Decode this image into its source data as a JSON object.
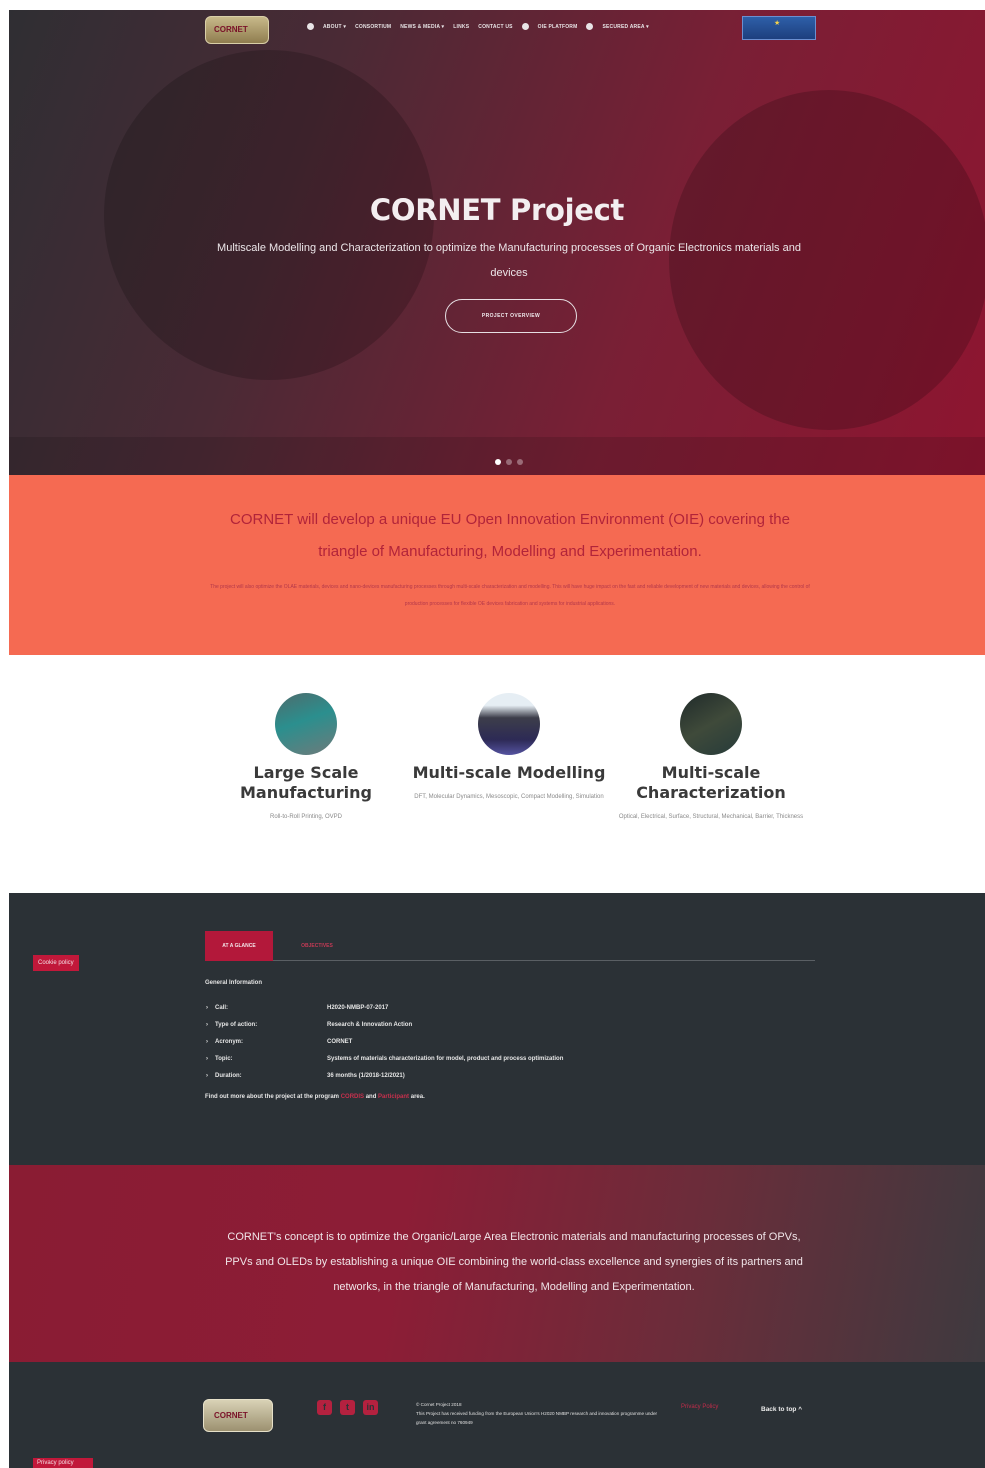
{
  "nav": {
    "logo": "CORNET",
    "items": [
      "ABOUT ▾",
      "CONSORTIUM",
      "NEWS & MEDIA ▾",
      "LINKS",
      "CONTACT US",
      "OIE PLATFORM",
      "SECURED AREA ▾"
    ],
    "eu_flag": "★"
  },
  "hero": {
    "title": "CORNET Project",
    "subtitle": "Multiscale Modelling and Characterization to optimize the Manufacturing processes of Organic Electronics materials and devices",
    "button": "PROJECT OVERVIEW"
  },
  "orange": {
    "headline": "CORNET will develop a unique EU Open Innovation Environment (OIE) covering the triangle of Manufacturing, Modelling and Experimentation.",
    "body": "The project will also optimize the OLAE materials, devices and nano-devices manufacturing processes through multi-scale characterization and modelling. This will have huge impact on the fast and reliable development of new materials and devices, allowing the control of production processes for flexible OE devices fabrication and systems for industrial applications."
  },
  "features": [
    {
      "title": "Large Scale Manufacturing",
      "desc": "Roll-to-Roll Printing, OVPD"
    },
    {
      "title": "Multi-scale Modelling",
      "desc": "DFT, Molecular Dynamics, Mesoscopic, Compact Modelling, Simulation"
    },
    {
      "title": "Multi-scale Characterization",
      "desc": "Optical, Electrical, Surface, Structural, Mechanical, Barrier, Thickness"
    }
  ],
  "info": {
    "cookie": "Cookie policy",
    "tab1": "AT A GLANCE",
    "tab2": "OBJECTIVES",
    "section_title": "General Information",
    "rows": [
      {
        "k": "Call:",
        "v": "H2020-NMBP-07-2017"
      },
      {
        "k": "Type of action:",
        "v": "Research & Innovation Action"
      },
      {
        "k": "Acronym:",
        "v": "CORNET"
      },
      {
        "k": "Topic:",
        "v": "Systems of materials characterization for model, product and process optimization"
      },
      {
        "k": "Duration:",
        "v": "36 months (1/2018-12/2021)"
      }
    ],
    "find_prefix": "Find out more about the project at the program",
    "link1": "CORDIS",
    "find_mid": "and",
    "link2": "Participant",
    "find_suffix": "area."
  },
  "quote": {
    "text": "CORNET's concept is to optimize the Organic/Large Area Electronic materials and manufacturing processes of OPVs, PPVs and OLEDs by establishing a unique OIE combining the world-class excellence and synergies of its partners and networks, in the triangle of Manufacturing, Modelling and Experimentation."
  },
  "footer": {
    "logo": "CORNET",
    "social": [
      "f",
      "t",
      "in"
    ],
    "copyright": "© Cornet Project 2018",
    "funding": "This Project has received funding from the European Union's H2020 NMBP research and innovation programme under grant agreement no 760949",
    "privacy": "Privacy Policy",
    "back_to_top": "Back to top ^",
    "bottom_link": "Privacy policy"
  }
}
